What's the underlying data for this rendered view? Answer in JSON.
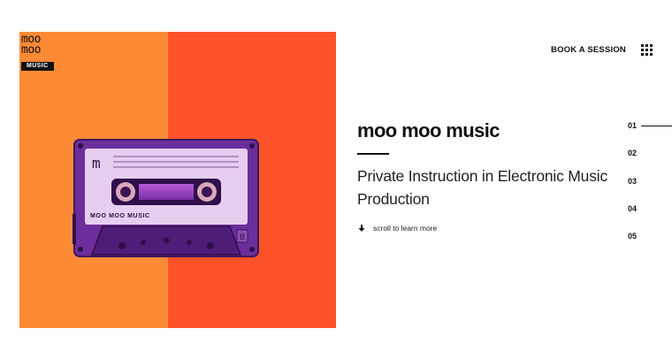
{
  "logo": {
    "line1": "moo",
    "line2": "moo",
    "tag": "MUSIC"
  },
  "cassette": {
    "label_letter": "m",
    "label_text": "MOO MOO MUSIC",
    "side": "B"
  },
  "nav": {
    "book_label": "BOOK A SESSION",
    "menu_icon": "grid-icon"
  },
  "hero": {
    "title": "moo moo music",
    "subtitle": "Private Instruction in Electronic Music Production",
    "scroll_label": "scroll to learn more",
    "scroll_icon": "arrow-down-icon"
  },
  "pager": {
    "items": [
      "01",
      "02",
      "03",
      "04",
      "05"
    ],
    "active_index": 0
  },
  "colors": {
    "orange": "#fd8a35",
    "red_orange": "#fe532a",
    "cassette_purple": "#6a2e9a",
    "label_lavender": "#e7cdf0",
    "text": "#111111"
  }
}
